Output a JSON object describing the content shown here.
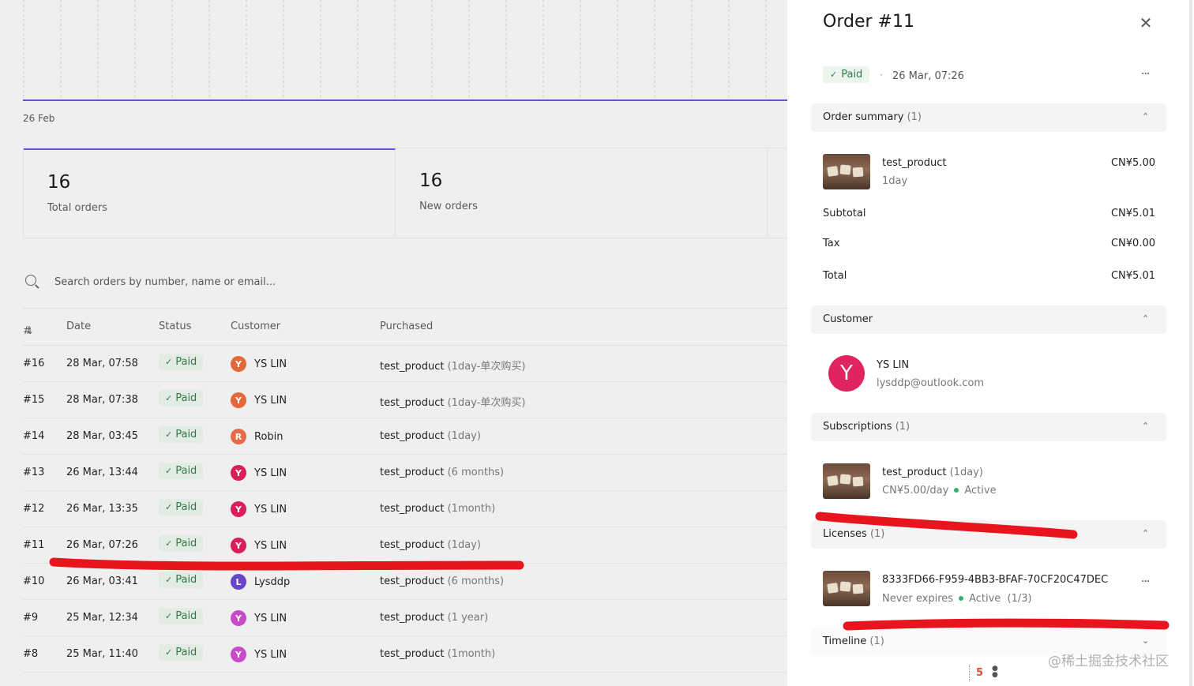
{
  "chart": {
    "x_label": "26 Feb",
    "line_color": "#6c4fd8"
  },
  "stats": [
    {
      "value": "16",
      "label": "Total orders"
    },
    {
      "value": "16",
      "label": "New orders"
    }
  ],
  "search": {
    "placeholder": "Search orders by number, name or email..."
  },
  "table": {
    "columns": {
      "number": "#",
      "date": "Date",
      "status": "Status",
      "customer": "Customer",
      "purchased": "Purchased"
    },
    "rows": [
      {
        "number": "#16",
        "date": "28 Mar, 07:58",
        "status": "Paid",
        "initial": "Y",
        "avatar_color": "#e5683a",
        "customer": "YS LIN",
        "product": "test_product",
        "variant": "(1day-单次购买)"
      },
      {
        "number": "#15",
        "date": "28 Mar, 07:38",
        "status": "Paid",
        "initial": "Y",
        "avatar_color": "#e5683a",
        "customer": "YS LIN",
        "product": "test_product",
        "variant": "(1day-单次购买)"
      },
      {
        "number": "#14",
        "date": "28 Mar, 03:45",
        "status": "Paid",
        "initial": "R",
        "avatar_color": "#e56a45",
        "customer": "Robin",
        "product": "test_product",
        "variant": "(1day)"
      },
      {
        "number": "#13",
        "date": "26 Mar, 13:44",
        "status": "Paid",
        "initial": "Y",
        "avatar_color": "#d91e5a",
        "customer": "YS LIN",
        "product": "test_product",
        "variant": "(6 months)"
      },
      {
        "number": "#12",
        "date": "26 Mar, 13:35",
        "status": "Paid",
        "initial": "Y",
        "avatar_color": "#d91e5a",
        "customer": "YS LIN",
        "product": "test_product",
        "variant": "(1month)"
      },
      {
        "number": "#11",
        "date": "26 Mar, 07:26",
        "status": "Paid",
        "initial": "Y",
        "avatar_color": "#d91e5a",
        "customer": "YS LIN",
        "product": "test_product",
        "variant": "(1day)"
      },
      {
        "number": "#10",
        "date": "26 Mar, 03:41",
        "status": "Paid",
        "initial": "L",
        "avatar_color": "#6a44c8",
        "customer": "Lysddp",
        "product": "test_product",
        "variant": "(6 months)"
      },
      {
        "number": "#9",
        "date": "25 Mar, 12:34",
        "status": "Paid",
        "initial": "Y",
        "avatar_color": "#c94ac9",
        "customer": "YS LIN",
        "product": "test_product",
        "variant": "(1 year)"
      },
      {
        "number": "#8",
        "date": "25 Mar, 11:40",
        "status": "Paid",
        "initial": "Y",
        "avatar_color": "#c94ac9",
        "customer": "YS LIN",
        "product": "test_product",
        "variant": "(1month)"
      }
    ]
  },
  "panel": {
    "title": "Order #11",
    "status": "Paid",
    "date": "26 Mar, 07:26",
    "summary": {
      "heading": "Order summary",
      "count": "(1)",
      "item_name": "test_product",
      "item_variant": "1day",
      "item_price": "CN¥5.00",
      "subtotal_label": "Subtotal",
      "subtotal": "CN¥5.01",
      "tax_label": "Tax",
      "tax": "CN¥0.00",
      "total_label": "Total",
      "total": "CN¥5.01"
    },
    "customer": {
      "heading": "Customer",
      "initial": "Y",
      "name": "YS LIN",
      "email": "lysddp@outlook.com"
    },
    "subscriptions": {
      "heading": "Subscriptions",
      "count": "(1)",
      "name": "test_product",
      "variant": "(1day)",
      "price": "CN¥5.00/day",
      "status": "Active"
    },
    "licenses": {
      "heading": "Licenses",
      "count": "(1)",
      "key": "8333FD66-F959-4BB3-BFAF-70CF20C47DEC",
      "expiry": "Never expires",
      "status": "Active",
      "usage": "(1/3)"
    },
    "timeline": {
      "heading": "Timeline",
      "count": "(1)"
    }
  },
  "watermark": "@稀土掘金技术社区",
  "colors": {
    "accent": "#6c4fd8",
    "paid_text": "#2f7a47",
    "annotation": "#e8141e"
  }
}
